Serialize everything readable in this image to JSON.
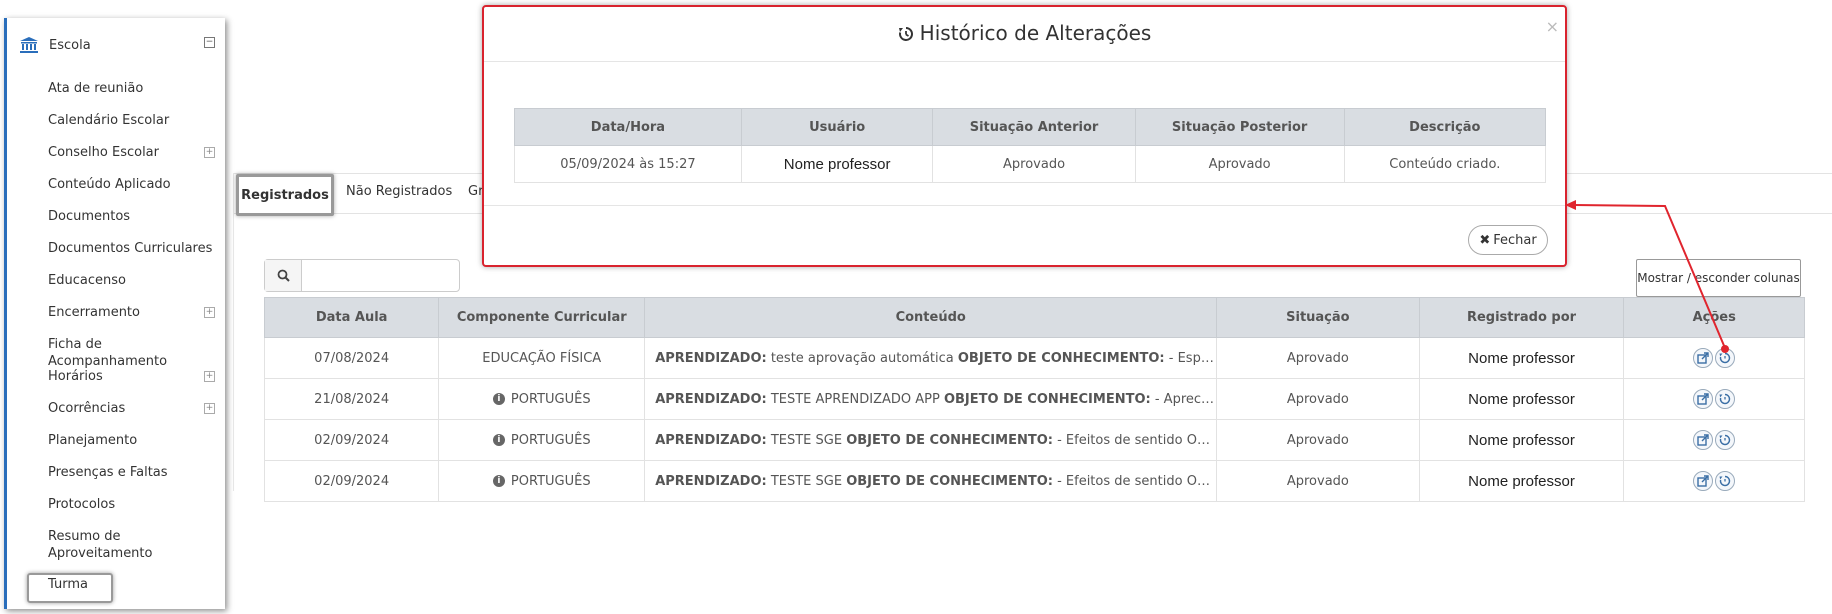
{
  "sidebar": {
    "header": "Escola",
    "items": [
      {
        "label": "Ata de reunião",
        "expand": false
      },
      {
        "label": "Calendário Escolar",
        "expand": false
      },
      {
        "label": "Conselho Escolar",
        "expand": true
      },
      {
        "label": "Conteúdo Aplicado",
        "expand": false
      },
      {
        "label": "Documentos",
        "expand": false
      },
      {
        "label": "Documentos Curriculares",
        "expand": false
      },
      {
        "label": "Educacenso",
        "expand": false
      },
      {
        "label": "Encerramento",
        "expand": true
      },
      {
        "label": "Ficha de Acompanhamento",
        "expand": false
      },
      {
        "label": "Horários",
        "expand": true
      },
      {
        "label": "Ocorrências",
        "expand": true
      },
      {
        "label": "Planejamento",
        "expand": false
      },
      {
        "label": "Presenças e Faltas",
        "expand": false
      },
      {
        "label": "Protocolos",
        "expand": false
      },
      {
        "label": "Resumo de Aproveitamento",
        "expand": false
      },
      {
        "label": "Turma",
        "expand": false
      }
    ]
  },
  "tabs": [
    "Registrados",
    "Não Registrados",
    "Gr"
  ],
  "toolbar": {
    "search_value": "",
    "columns_button": "Mostrar / esconder colunas"
  },
  "table": {
    "headers": [
      "Data Aula",
      "Componente Curricular",
      "Conteúdo",
      "Situação",
      "Registrado por",
      "Ações"
    ],
    "rows": [
      {
        "date": "07/08/2024",
        "info": false,
        "component": "EDUCAÇÃO FÍSICA",
        "c1": "APRENDIZADO:",
        "c2": " teste aprovação automática ",
        "c3": "OBJETO DE CONHECIMENTO:",
        "c4": " - Esportes d...",
        "status": "Aprovado",
        "by": "Nome professor"
      },
      {
        "date": "21/08/2024",
        "info": true,
        "component": "PORTUGUÊS",
        "c1": "APRENDIZADO:",
        "c2": " TESTE APRENDIZADO APP ",
        "c3": "OBJETO DE CONHECIMENTO:",
        "c4": " - Apreciação e...",
        "status": "Aprovado",
        "by": "Nome professor"
      },
      {
        "date": "02/09/2024",
        "info": true,
        "component": "PORTUGUÊS",
        "c1": "APRENDIZADO:",
        "c2": " TESTE SGE ",
        "c3": "OBJETO DE CONHECIMENTO:",
        "c4": " - Efeitos de sentido OBJETO ...",
        "status": "Aprovado",
        "by": "Nome professor"
      },
      {
        "date": "02/09/2024",
        "info": true,
        "component": "PORTUGUÊS",
        "c1": "APRENDIZADO:",
        "c2": " TESTE SGE ",
        "c3": "OBJETO DE CONHECIMENTO:",
        "c4": " - Efeitos de sentido OBJETO ...",
        "status": "Aprovado",
        "by": "Nome professor"
      }
    ]
  },
  "modal": {
    "title": "Histórico de Alterações",
    "close_symbol": "×",
    "headers": [
      "Data/Hora",
      "Usuário",
      "Situação Anterior",
      "Situação Posterior",
      "Descrição"
    ],
    "row": {
      "datetime": "05/09/2024 às 15:27",
      "user": "Nome professor",
      "before": "Aprovado",
      "after": "Aprovado",
      "description": "Conteúdo criado."
    },
    "close_button": "Fechar"
  },
  "colors": {
    "accent": "#2a6ebb",
    "highlight": "#d9232e",
    "header_bg": "#d9dde2"
  }
}
